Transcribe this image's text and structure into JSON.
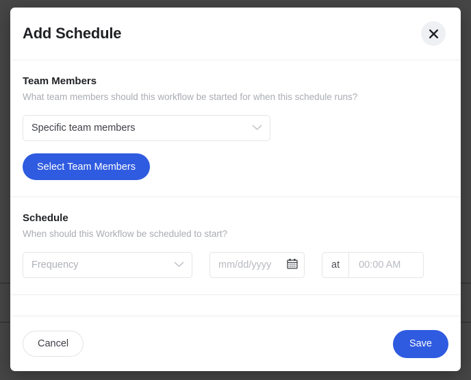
{
  "modal": {
    "title": "Add Schedule",
    "close_icon": "close-icon"
  },
  "team_members": {
    "heading": "Team Members",
    "description": "What team members should this workflow be started for when this schedule runs?",
    "select": {
      "value": "Specific team members",
      "chevron_icon": "chevron-down-icon"
    },
    "select_button_label": "Select Team Members"
  },
  "schedule": {
    "heading": "Schedule",
    "description": "When should this Workflow be scheduled to start?",
    "frequency": {
      "placeholder": "Frequency",
      "chevron_icon": "chevron-down-icon"
    },
    "date": {
      "placeholder": "mm/dd/yyyy",
      "calendar_icon": "calendar-icon"
    },
    "time": {
      "prefix_label": "at",
      "placeholder": "00:00 AM"
    }
  },
  "footer": {
    "cancel_label": "Cancel",
    "save_label": "Save"
  },
  "colors": {
    "primary": "#2f5be0",
    "backdrop": "#282828",
    "text": "#1f2124",
    "muted": "#a9acb2",
    "border": "#e3e5e8"
  }
}
